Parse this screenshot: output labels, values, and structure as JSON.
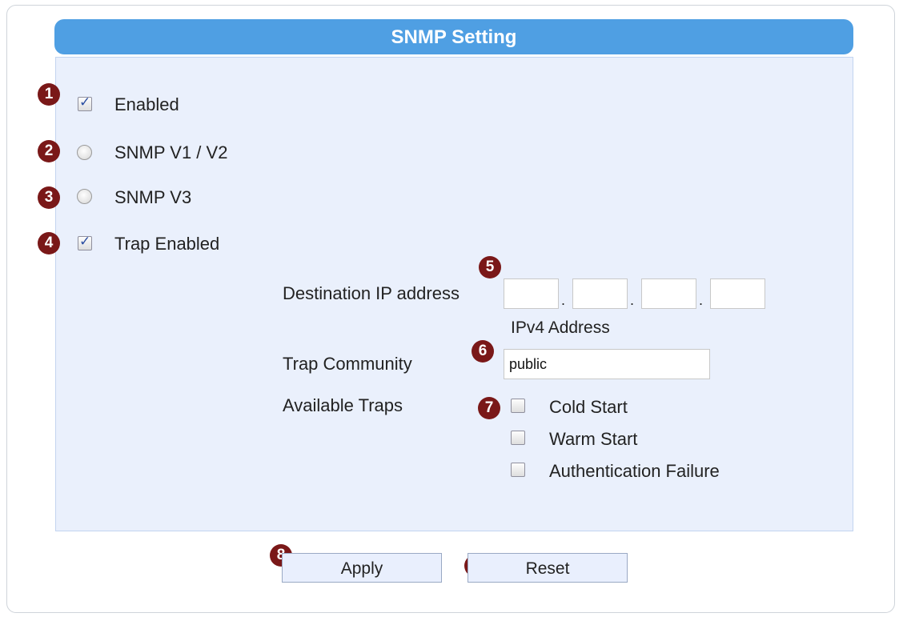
{
  "title": "SNMP Setting",
  "options": {
    "enabled": {
      "label": "Enabled",
      "checked": true,
      "badge": "1"
    },
    "v1v2": {
      "label": "SNMP V1 / V2",
      "selected": false,
      "badge": "2"
    },
    "v3": {
      "label": "SNMP V3",
      "selected": false,
      "badge": "3"
    },
    "trap_enabled": {
      "label": "Trap Enabled",
      "checked": true,
      "badge": "4"
    }
  },
  "destination": {
    "label": "Destination IP address",
    "badge": "5",
    "octets": [
      "",
      "",
      "",
      ""
    ],
    "separator": ".",
    "hint": "IPv4 Address"
  },
  "trap_community": {
    "label": "Trap Community",
    "value": "public",
    "badge": "6"
  },
  "available_traps": {
    "label": "Available Traps",
    "badge": "7",
    "items": [
      {
        "label": "Cold Start",
        "checked": false
      },
      {
        "label": "Warm Start",
        "checked": false
      },
      {
        "label": "Authentication Failure",
        "checked": false
      }
    ]
  },
  "buttons": {
    "apply": {
      "label": "Apply",
      "badge": "8"
    },
    "reset": {
      "label": "Reset",
      "badge": "9"
    }
  },
  "colors": {
    "title_bar": "#4f9fe3",
    "panel": "#eaf0fc",
    "badge": "#7a1818"
  }
}
